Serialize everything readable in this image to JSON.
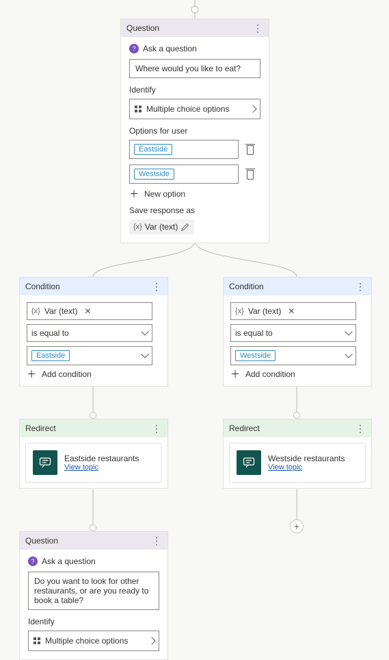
{
  "question1": {
    "header": "Question",
    "subtitle": "Ask a question",
    "prompt": "Where would you like to eat?",
    "identify_label": "Identify",
    "identify_value": "Multiple choice options",
    "options_label": "Options for user",
    "options": [
      "Eastside",
      "Westside"
    ],
    "new_option": "New option",
    "save_label": "Save response as",
    "var_brace": "{x}",
    "var_text": "Var (text)"
  },
  "condition_left": {
    "header": "Condition",
    "var_brace": "{x}",
    "var_text": "Var (text)",
    "op": "is equal to",
    "value": "Eastside",
    "add": "Add condition"
  },
  "condition_right": {
    "header": "Condition",
    "var_brace": "{x}",
    "var_text": "Var (text)",
    "op": "is equal to",
    "value": "Westside",
    "add": "Add condition"
  },
  "redirect_left": {
    "header": "Redirect",
    "title": "Eastside restaurants",
    "link": "View topic"
  },
  "redirect_right": {
    "header": "Redirect",
    "title": "Westside restaurants",
    "link": "View topic"
  },
  "question2": {
    "header": "Question",
    "subtitle": "Ask a question",
    "prompt": "Do you want to look for other restaurants, or are you ready to book a table?",
    "identify_label": "Identify",
    "identify_value": "Multiple choice options"
  }
}
